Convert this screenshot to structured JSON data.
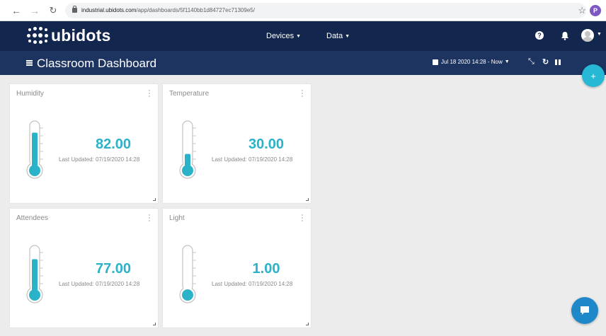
{
  "browser": {
    "url_host": "industrial.ubidots.com",
    "url_path": "/app/dashboards/5f1140bb1d84727ec71309e5/",
    "profile_initial": "P"
  },
  "header": {
    "logo_text": "ubidots",
    "menu": [
      {
        "label": "Devices"
      },
      {
        "label": "Data"
      }
    ],
    "help_icon": "?"
  },
  "dashboard": {
    "title": "Classroom Dashboard",
    "date_range": "Jul 18 2020 14:28 - Now"
  },
  "widgets": [
    {
      "title": "Humidity",
      "value": "82.00",
      "updated": "Last Updated: 07/19/2020 14:28",
      "level": 0.82
    },
    {
      "title": "Temperature",
      "value": "30.00",
      "updated": "Last Updated: 07/19/2020 14:28",
      "level": 0.3
    },
    {
      "title": "Attendees",
      "value": "77.00",
      "updated": "Last Updated: 07/19/2020 14:28",
      "level": 0.77
    },
    {
      "title": "Light",
      "value": "1.00",
      "updated": "Last Updated: 07/19/2020 14:28",
      "level": 0.01
    }
  ],
  "colors": {
    "header_bg": "#13264d",
    "subheader_bg": "#1d3461",
    "accent": "#2ab2c9",
    "chat_button": "#1f88c9"
  },
  "icons": {
    "add": "plus-icon",
    "chat": "chat-icon",
    "calendar": "calendar-icon",
    "expand": "expand-icon",
    "refresh": "refresh-icon",
    "pause": "pause-icon"
  }
}
